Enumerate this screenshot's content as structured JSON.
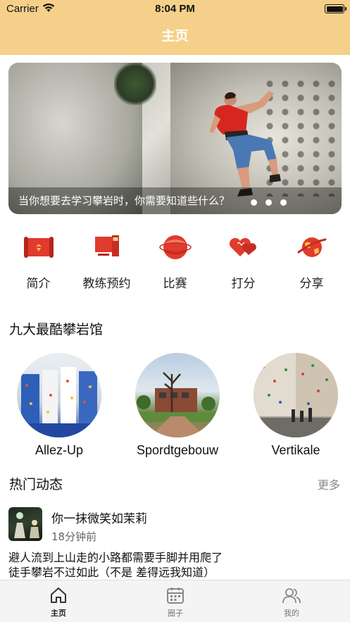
{
  "status_bar": {
    "carrier": "Carrier",
    "time": "8:04 PM"
  },
  "nav": {
    "title": "主页"
  },
  "banner": {
    "caption": "当你想要去学习攀岩时，你需要知道些什么？",
    "page_count": 3
  },
  "quick_menu": [
    {
      "label": "简介",
      "icon": "scroll-icon"
    },
    {
      "label": "教练预约",
      "icon": "monitor-icon"
    },
    {
      "label": "比赛",
      "icon": "planet-icon"
    },
    {
      "label": "打分",
      "icon": "hearts-icon"
    },
    {
      "label": "分享",
      "icon": "globe-icon"
    }
  ],
  "gyms_section": {
    "title": "九大最酷攀岩馆"
  },
  "gyms": [
    {
      "name": "Allez-Up"
    },
    {
      "name": "Spordtgebouw"
    },
    {
      "name": "Vertikale"
    }
  ],
  "feed_section": {
    "title": "热门动态",
    "more": "更多"
  },
  "post": {
    "user": "你一抹微笑如茉莉",
    "time": "18分钟前",
    "line1": "避人流到上山走的小路都需要手脚并用爬了",
    "line2": "徒手攀岩不过如此（不是 差得远我知道）"
  },
  "tabbar": [
    {
      "label": "主页",
      "icon": "home-icon",
      "active": true
    },
    {
      "label": "圈子",
      "icon": "calendar-icon",
      "active": false
    },
    {
      "label": "我的",
      "icon": "user-group-icon",
      "active": false
    }
  ],
  "colors": {
    "header": "#f5d08a",
    "accent_red": "#e03b2c"
  }
}
